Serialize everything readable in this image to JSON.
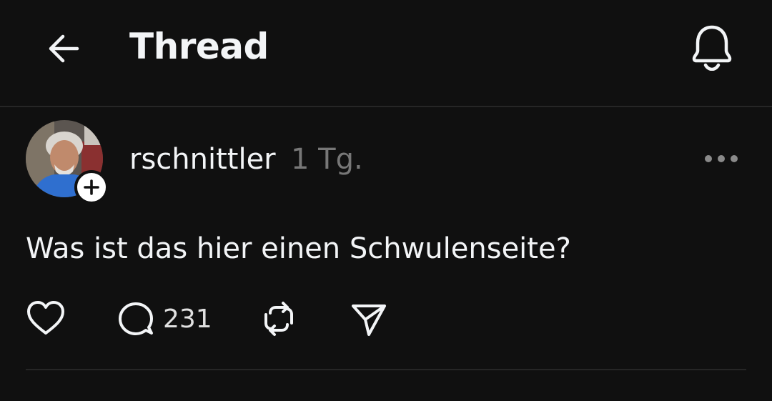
{
  "header": {
    "title": "Thread",
    "back_icon": "arrow-left-icon",
    "notify_icon": "bell-icon"
  },
  "post": {
    "username": "rschnittler",
    "time": "1 Tg.",
    "text": "Was ist das hier einen Schwulenseite?",
    "reply_count": "231",
    "more_icon": "ellipsis-icon"
  },
  "colors": {
    "background": "#101010",
    "text": "#f3f5f7",
    "muted": "#777777",
    "divider": "#262626"
  }
}
